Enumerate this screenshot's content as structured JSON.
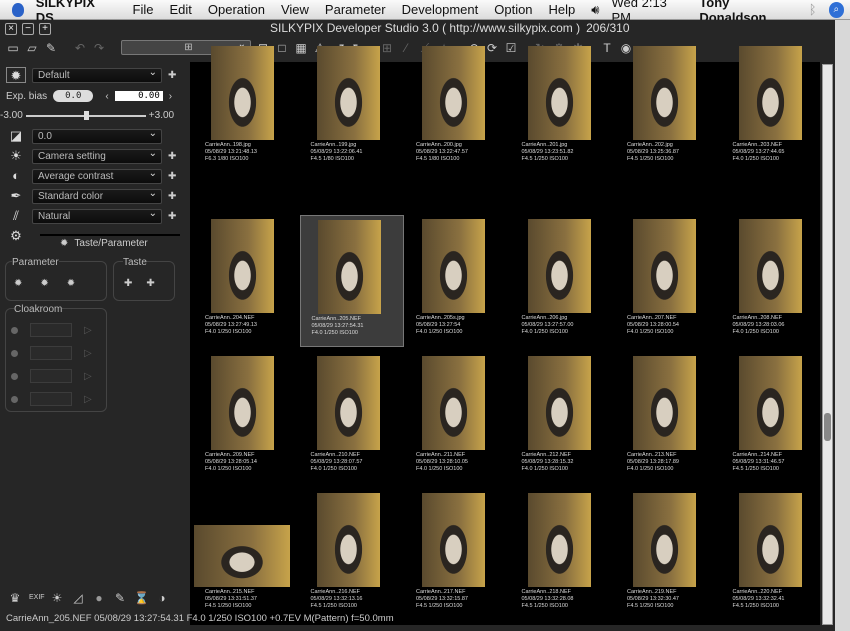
{
  "menubar": {
    "app": "SILKYPIX DS",
    "items": [
      "File",
      "Edit",
      "Operation",
      "View",
      "Parameter",
      "Development",
      "Option",
      "Help"
    ],
    "clock": "Wed 2:13 PM",
    "user": "Tony Donaldson"
  },
  "window": {
    "title": "SILKYPIX Developer Studio 3.0 ( http://www.silkypix.com )",
    "counter": "206/310"
  },
  "panel": {
    "taste": "Default",
    "exp_bias_label": "Exp. bias",
    "exp_bias": "0.0",
    "exp_value": "0.00",
    "slider_min": "-3.00",
    "slider_max": "+3.00",
    "slider_fraction": 0.5,
    "ev_comp": "0.0",
    "white_balance": "Camera setting",
    "contrast": "Average contrast",
    "color": "Standard color",
    "sharpness": "Natural",
    "tab": "Taste/Parameter",
    "parameter_group": "Parameter",
    "taste_group": "Taste",
    "cloakroom": "Cloakroom"
  },
  "thumbs": [
    {
      "name": "CarrieAnn..198.jpg",
      "date": "05/08/29 13:21:48.13",
      "exif": "F6.3 1/80 ISO100"
    },
    {
      "name": "CarrieAnn..199.jpg",
      "date": "05/08/29 13:22:06.41",
      "exif": "F4.5 1/80 ISO100"
    },
    {
      "name": "CarrieAnn..200.jpg",
      "date": "05/08/29 13:22:47.57",
      "exif": "F4.5 1/80 ISO100"
    },
    {
      "name": "CarrieAnn..201.jpg",
      "date": "05/08/29 13:23:51.82",
      "exif": "F4.5 1/250 ISO100"
    },
    {
      "name": "CarrieAnn..202.jpg",
      "date": "05/08/29 13:25:36.87",
      "exif": "F4.5 1/250 ISO100"
    },
    {
      "name": "CarrieAnn..203.NEF",
      "date": "05/08/29 13:27:44.65",
      "exif": "F4.0 1/250 ISO100"
    },
    {
      "name": "CarrieAnn..204.NEF",
      "date": "05/08/29 13:27:49.13",
      "exif": "F4.0 1/250 ISO100"
    },
    {
      "name": "CarrieAnn..205.NEF",
      "date": "05/08/29 13:27:54.31",
      "exif": "F4.0 1/250 ISO100",
      "selected": true
    },
    {
      "name": "CarrieAnn..205s.jpg",
      "date": "05/08/29 13:27:54",
      "exif": "F4.0 1/250 ISO100"
    },
    {
      "name": "CarrieAnn..206.jpg",
      "date": "05/08/29 13:27:57.00",
      "exif": "F4.0 1/250 ISO100"
    },
    {
      "name": "CarrieAnn..207.NEF",
      "date": "05/08/29 13:28:00.54",
      "exif": "F4.0 1/250 ISO100"
    },
    {
      "name": "CarrieAnn..208.NEF",
      "date": "05/08/29 13:28:03.06",
      "exif": "F4.0 1/250 ISO100"
    },
    {
      "name": "CarrieAnn..209.NEF",
      "date": "05/08/29 13:28:05.14",
      "exif": "F4.0 1/250 ISO100"
    },
    {
      "name": "CarrieAnn..210.NEF",
      "date": "05/08/29 13:28:07.57",
      "exif": "F4.0 1/250 ISO100"
    },
    {
      "name": "CarrieAnn..211.NEF",
      "date": "05/08/29 13:28:10.05",
      "exif": "F4.0 1/250 ISO100"
    },
    {
      "name": "CarrieAnn..212.NEF",
      "date": "05/08/29 13:28:15.32",
      "exif": "F4.0 1/250 ISO100"
    },
    {
      "name": "CarrieAnn..213.NEF",
      "date": "05/08/29 13:28:17.89",
      "exif": "F4.0 1/250 ISO100"
    },
    {
      "name": "CarrieAnn..214.NEF",
      "date": "05/08/29 13:31:46.57",
      "exif": "F4.5 1/250 ISO100"
    },
    {
      "name": "CarrieAnn..215.NEF",
      "date": "05/08/29 13:31:51.37",
      "exif": "F4.5 1/250 ISO100",
      "landscape": true
    },
    {
      "name": "CarrieAnn..216.NEF",
      "date": "05/08/29 13:32:13.16",
      "exif": "F4.5 1/250 ISO100"
    },
    {
      "name": "CarrieAnn..217.NEF",
      "date": "05/08/29 13:32:15.87",
      "exif": "F4.5 1/250 ISO100"
    },
    {
      "name": "CarrieAnn..218.NEF",
      "date": "05/08/29 13:32:28.08",
      "exif": "F4.5 1/250 ISO100"
    },
    {
      "name": "CarrieAnn..219.NEF",
      "date": "05/08/29 13:32:30.47",
      "exif": "F4.5 1/250 ISO100"
    },
    {
      "name": "CarrieAnn..220.NEF",
      "date": "05/08/29 13:32:32.41",
      "exif": "F4.5 1/250 ISO100"
    }
  ],
  "status": "CarrieAnn_205.NEF 05/08/29 13:27:54.31 F4.0 1/250 ISO100 +0.7EV M(Pattern) f=50.0mm"
}
